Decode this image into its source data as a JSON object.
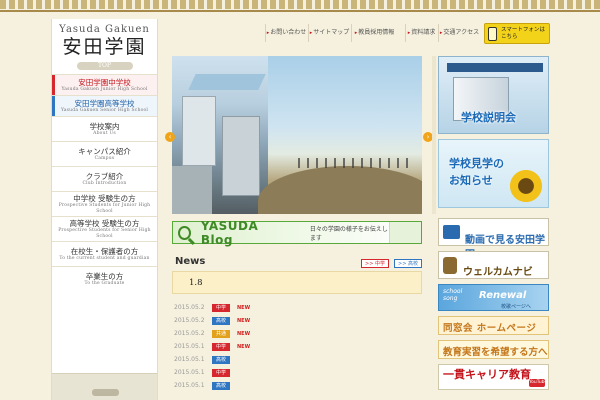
{
  "brand": {
    "name_en": "Yasuda Gakuen",
    "name_jp": "安田学園",
    "top_label": "TOP"
  },
  "nav": [
    {
      "jp": "安田学園中学校",
      "en": "Yasuda Gakuen Junior High School"
    },
    {
      "jp": "安田学園高等学校",
      "en": "Yasuda Gakuen Senior High School"
    },
    {
      "jp": "学校案内",
      "en": "About Us"
    },
    {
      "jp": "キャンパス紹介",
      "en": "Campus"
    },
    {
      "jp": "クラブ紹介",
      "en": "Club Introduction"
    },
    {
      "jp": "中学校 受験生の方",
      "en": "Prospective Students for Junior High School"
    },
    {
      "jp": "高等学校 受験生の方",
      "en": "Prospective Students for Senior High School"
    },
    {
      "jp": "在校生・保護者の方",
      "en": "To the current student and guardian"
    },
    {
      "jp": "卒業生の方",
      "en": "To the Graduate"
    }
  ],
  "header_links": [
    "お問い合わせ",
    "サイトマップ",
    "教員採用情報",
    "資料請求",
    "交通アクセス"
  ],
  "smartphone": {
    "line1": "スマートフォンは",
    "line2": "こちら"
  },
  "blog": {
    "title": "YASUDA Blog",
    "subtitle": "日々の学園の様子をお伝えします"
  },
  "news": {
    "title": "News",
    "more_jh": ">> 中学",
    "more_sh": ">> 高校",
    "featured": "1.8",
    "items": [
      {
        "date": "2015.05.2",
        "cat": "中学",
        "cat_type": "jh",
        "new": "NEW"
      },
      {
        "date": "2015.05.2",
        "cat": "高校",
        "cat_type": "sh",
        "new": "NEW"
      },
      {
        "date": "2015.05.2",
        "cat": "共通",
        "cat_type": "all",
        "new": "NEW"
      },
      {
        "date": "2015.05.1",
        "cat": "中学",
        "cat_type": "jh",
        "new": "NEW"
      },
      {
        "date": "2015.05.1",
        "cat": "高校",
        "cat_type": "sh",
        "new": ""
      },
      {
        "date": "2015.05.1",
        "cat": "中学",
        "cat_type": "jh",
        "new": ""
      },
      {
        "date": "2015.05.1",
        "cat": "高校",
        "cat_type": "sh",
        "new": ""
      }
    ]
  },
  "banners": {
    "info_session": "学校説明会",
    "visit_line1": "学校見学の",
    "visit_line2": "お知らせ",
    "video_main": "動画で見る安田学園",
    "welcome_main": "ウェルカムナビ",
    "song_tag1": "school",
    "song_tag2": "song",
    "song_main": "Renewal",
    "song_sub": "校歌ページへ",
    "alumni": "同窓会 ホームページ",
    "teacher": "教育実習を希望する方へ",
    "career_main": "一貫キャリア教育",
    "youtube": "YouTube"
  },
  "colors": {
    "jh_red": "#d6262e",
    "sh_blue": "#2f76c2",
    "blog_green": "#3f8a26",
    "background": "#f6f1de"
  }
}
